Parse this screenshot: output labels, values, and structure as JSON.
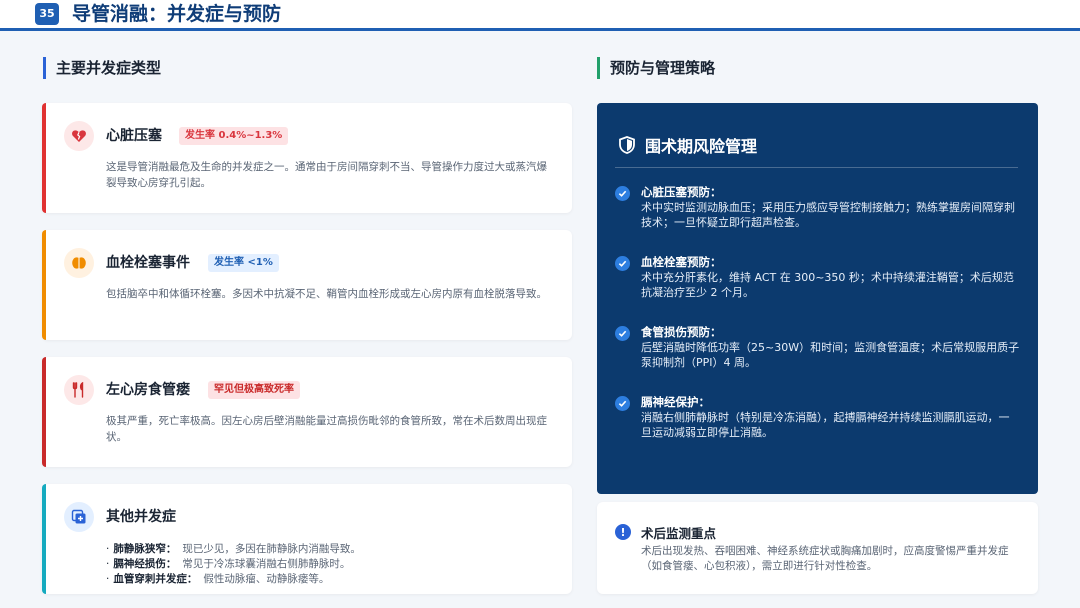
{
  "header": {
    "slide_number": "35",
    "title": "导管消融：并发症与预防"
  },
  "left_section": {
    "title": "主要并发症类型",
    "cards": [
      {
        "title": "心脏压塞",
        "icon": "broken-heart-icon",
        "badge": "发生率 0.4%~1.3%",
        "desc": "这是导管消融最危及生命的并发症之一。通常由于房间隔穿刺不当、导管操作力度过大或蒸汽爆裂导致心房穿孔引起。",
        "accent": "#e03131"
      },
      {
        "title": "血栓栓塞事件",
        "icon": "brain-icon",
        "badge": "发生率 <1%",
        "desc": "包括脑卒中和体循环栓塞。多因术中抗凝不足、鞘管内血栓形成或左心房内原有血栓脱落导致。",
        "accent": "#f08c00"
      },
      {
        "title": "左心房食管瘘",
        "icon": "utensils-icon",
        "badge": "罕见但极高致死率",
        "desc": "极其严重，死亡率极高。因左心房后壁消融能量过高损伤毗邻的食管所致，常在术后数周出现症状。",
        "accent": "#c92a2a"
      },
      {
        "title": "其他并发症",
        "icon": "plus-square-icon",
        "accent": "#15aabf",
        "items": [
          {
            "bullet": "·",
            "label": "肺静脉狭窄：",
            "text": "现已少见，多因在肺静脉内消融导致。"
          },
          {
            "bullet": "·",
            "label": "膈神经损伤：",
            "text": "常见于冷冻球囊消融右侧肺静脉时。"
          },
          {
            "bullet": "·",
            "label": "血管穿刺并发症：",
            "text": "假性动脉瘤、动静脉瘘等。"
          }
        ]
      }
    ]
  },
  "right_section": {
    "title": "预防与管理策略",
    "panel": {
      "title": "围术期风险管理",
      "icon": "shield-icon",
      "items": [
        {
          "title": "心脏压塞预防：",
          "desc": "术中实时监测动脉血压；采用压力感应导管控制接触力；熟练掌握房间隔穿刺技术；一旦怀疑立即行超声检查。"
        },
        {
          "title": "血栓栓塞预防：",
          "desc": "术中充分肝素化，维持 ACT 在 300~350 秒；术中持续灌注鞘管；术后规范抗凝治疗至少 2 个月。"
        },
        {
          "title": "食管损伤预防：",
          "desc": "后壁消融时降低功率（25~30W）和时间；监测食管温度；术后常规服用质子泵抑制剂（PPI）4 周。"
        },
        {
          "title": "膈神经保护：",
          "desc": "消融右侧肺静脉时（特别是冷冻消融），起搏膈神经并持续监测膈肌运动，一旦运动减弱立即停止消融。"
        }
      ]
    },
    "monitor": {
      "icon_text": "!",
      "title": "术后监测重点",
      "desc": "术后出现发热、吞咽困难、神经系统症状或胸痛加剧时，应高度警惕严重并发症（如食管瘘、心包积液），需立即进行针对性检查。"
    }
  }
}
